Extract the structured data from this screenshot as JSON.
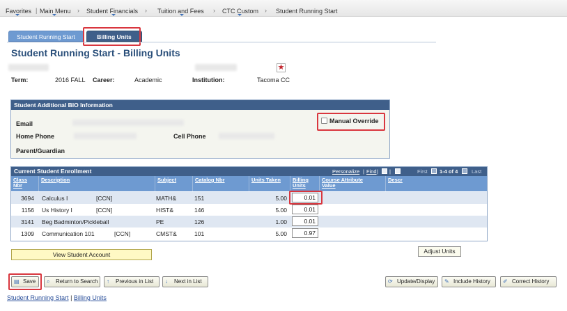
{
  "breadcrumb": {
    "items": [
      "Favorites",
      "Main Menu",
      "Student Financials",
      "Tuition and Fees",
      "CTC Custom",
      "Student Running Start"
    ]
  },
  "tabs": [
    {
      "label": "Student Running Start",
      "active": false
    },
    {
      "label": "Billing Units",
      "active": true
    }
  ],
  "page_title": "Student Running Start - Billing Units",
  "term": {
    "label": "Term:",
    "value": "2016 FALL"
  },
  "career": {
    "label": "Career:",
    "value": "Academic"
  },
  "institution": {
    "label": "Institution:",
    "value": "Tacoma CC"
  },
  "bio": {
    "header": "Student Additional BIO Information",
    "email_label": "Email",
    "home_phone_label": "Home Phone",
    "cell_phone_label": "Cell Phone",
    "parent_label": "Parent/Guardian",
    "manual_override_label": "Manual Override",
    "manual_override_checked": false
  },
  "enrollment": {
    "title": "Current Student Enrollment",
    "nav": {
      "personalize": "Personalize",
      "find": "Find",
      "first": "First",
      "range": "1-4 of 4",
      "last": "Last"
    },
    "columns": [
      "Class Nbr",
      "Description",
      "Subject",
      "Catalog Nbr",
      "Units Taken",
      "Billing Units",
      "Course Attribute Value",
      "Descr"
    ],
    "rows": [
      {
        "class_nbr": "3694",
        "description": "Calculus I",
        "attr": "[CCN]",
        "subject": "MATH&",
        "catalog": "151",
        "units": "5.00",
        "billing": "0.01"
      },
      {
        "class_nbr": "1156",
        "description": "Us History I",
        "attr": "[CCN]",
        "subject": "HIST&",
        "catalog": "146",
        "units": "5.00",
        "billing": "0.01"
      },
      {
        "class_nbr": "3141",
        "description": "Beg Badminton/Pickleball",
        "attr": "",
        "subject": "PE",
        "catalog": "126",
        "units": "1.00",
        "billing": "0.01"
      },
      {
        "class_nbr": "1309",
        "description": "Communication 101",
        "attr": "[CCN]",
        "subject": "CMST&",
        "catalog": "101",
        "units": "5.00",
        "billing": "0.97"
      }
    ]
  },
  "buttons": {
    "view_account": "View Student Account",
    "adjust_units": "Adjust Units",
    "save": "Save",
    "return_search": "Return to Search",
    "prev_list": "Previous in List",
    "next_list": "Next in List",
    "update_display": "Update/Display",
    "include_history": "Include History",
    "correct_history": "Correct History"
  },
  "footer": {
    "link1": "Student Running Start",
    "sep": " | ",
    "link2": "Billing Units"
  },
  "colors": {
    "header_dark": "#3f5f8a",
    "header_light": "#6e9ad1",
    "highlight": "#d9363e",
    "title": "#2a4f7a"
  }
}
